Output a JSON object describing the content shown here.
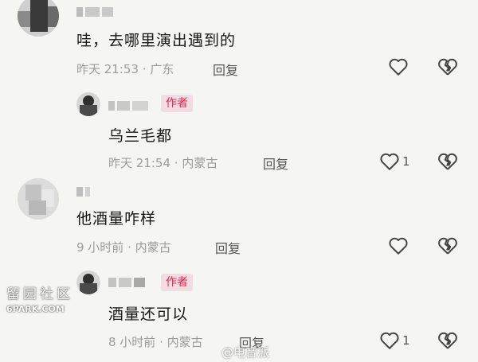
{
  "comments": [
    {
      "text": "哇，去哪里演出遇到的",
      "time": "昨天 21:53",
      "location": "广东",
      "reply_label": "回复",
      "like_count": "",
      "is_author": false
    },
    {
      "text": "乌兰毛都",
      "time": "昨天 21:54",
      "location": "内蒙古",
      "reply_label": "回复",
      "like_count": "1",
      "is_author": true,
      "badge": "作者"
    },
    {
      "text": "他酒量咋样",
      "time": "9 小时前",
      "location": "内蒙古",
      "reply_label": "回复",
      "like_count": "",
      "is_author": false
    },
    {
      "text": "酒量还可以",
      "time": "8 小时前",
      "location": "内蒙古",
      "reply_label": "回复",
      "like_count": "1",
      "is_author": true,
      "badge": "作者"
    }
  ],
  "separator": "·",
  "watermark_left": {
    "title": "留园社区",
    "url": "6PARK.COM"
  },
  "watermark_right": "@电音派",
  "icons": {
    "like": "heart-outline-icon",
    "dislike": "broken-heart-icon"
  },
  "colors": {
    "badge_text": "#e8254e",
    "badge_bg": "#f0dde2",
    "meta": "#9c9c9c",
    "background": "#f5f5f3"
  }
}
